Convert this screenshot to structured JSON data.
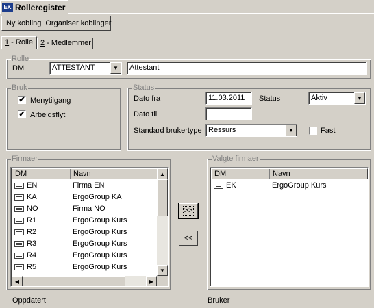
{
  "window": {
    "logo": "EK",
    "title": "Rolleregister"
  },
  "toolbar": {
    "new_link": "Ny kobling",
    "organize": "Organiser koblinger"
  },
  "tabs": [
    {
      "key": "1",
      "label": " - Rolle"
    },
    {
      "key": "2",
      "label": " - Medlemmer"
    }
  ],
  "rolle": {
    "legend": "Rolle",
    "dm_label": "DM",
    "dm_value": "ATTESTANT",
    "name_value": "Attestant"
  },
  "bruk": {
    "legend": "Bruk",
    "menu_access": {
      "label": "Menytilgang",
      "checked": "✔"
    },
    "workflow": {
      "label": "Arbeidsflyt",
      "checked": "✔"
    }
  },
  "status": {
    "legend": "Status",
    "date_from_label": "Dato fra",
    "date_from": "11.03.2011",
    "date_to_label": "Dato til",
    "date_to": "",
    "status_label": "Status",
    "status_value": "Aktiv",
    "user_type_label": "Standard brukertype",
    "user_type_value": "Ressurs",
    "fixed_label": "Fast"
  },
  "firms": {
    "legend": "Firmaer",
    "col_dm": "DM",
    "col_name": "Navn",
    "rows": [
      {
        "dm": "EN",
        "name": "Firma EN"
      },
      {
        "dm": "KA",
        "name": "ErgoGroup KA"
      },
      {
        "dm": "NO",
        "name": "Firma NO"
      },
      {
        "dm": "R1",
        "name": "ErgoGroup Kurs"
      },
      {
        "dm": "R2",
        "name": "ErgoGroup Kurs"
      },
      {
        "dm": "R3",
        "name": "ErgoGroup Kurs"
      },
      {
        "dm": "R4",
        "name": "ErgoGroup Kurs"
      },
      {
        "dm": "R5",
        "name": "ErgoGroup Kurs"
      }
    ]
  },
  "selected": {
    "legend": "Valgte firmaer",
    "col_dm": "DM",
    "col_name": "Navn",
    "rows": [
      {
        "dm": "EK",
        "name": "ErgoGroup Kurs"
      }
    ]
  },
  "buttons": {
    "add": ">>",
    "remove": "<<"
  },
  "footer": {
    "updated": "Oppdatert",
    "user": "Bruker"
  },
  "colors": {
    "face": "#d4d0c8",
    "logo_bg": "#1c3d8c"
  }
}
